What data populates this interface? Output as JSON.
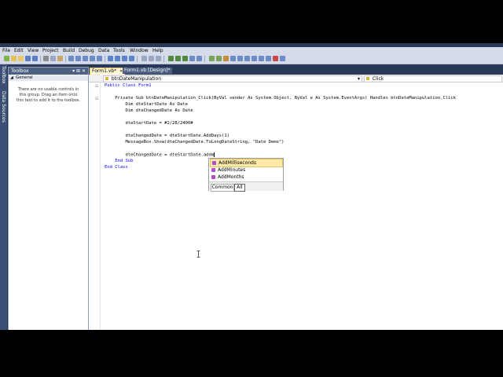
{
  "menu": [
    "File",
    "Edit",
    "View",
    "Project",
    "Build",
    "Debug",
    "Data",
    "Tools",
    "Window",
    "Help"
  ],
  "side_strip_label": "Data Sources",
  "toolbox": {
    "title": "Toolbox",
    "title_buttons": "▾ ⊞ ✕",
    "group": "General",
    "empty_message_1": "There are no usable controls in",
    "empty_message_2": "this group. Drag an item onto",
    "empty_message_3": "this text to add it to the toolbox."
  },
  "tabs": [
    {
      "label": "Form1.vb*",
      "active": true
    },
    {
      "label": "Form1.vb [Design]*",
      "active": false
    }
  ],
  "nav": {
    "left": "btnDateManipulation",
    "right": "Click"
  },
  "code": [
    "Public Class Form1",
    "",
    "    Private Sub btnDateManipulation_Click(ByVal sender As System.Object, ByVal e As System.EventArgs) Handles btnDateManipulation.Click",
    "        Dim dteStartDate As Date",
    "        Dim dteChangedDate As Date",
    "",
    "        dteStartDate = #2/28/2400#",
    "",
    "        dteChangedDate = dteStartDate.AddDays(1)",
    "        MessageBox.Show(dteChangedDate.ToLongDateString, \"Date Demo\")",
    "",
    "        dteChangedDate = dteStartDate.addm",
    "    End Sub",
    "End Class"
  ],
  "intellisense": {
    "items": [
      "AddMilliseconds",
      "AddMinutes",
      "AddMonths"
    ],
    "selected_index": 0,
    "tabs": [
      "Common",
      "All"
    ],
    "active_tab": "All"
  },
  "colors": {
    "ide_background": "#293955",
    "keyword": "#0000ff",
    "type": "#2b91af",
    "string": "#a31515",
    "selection": "#fde9a8"
  }
}
